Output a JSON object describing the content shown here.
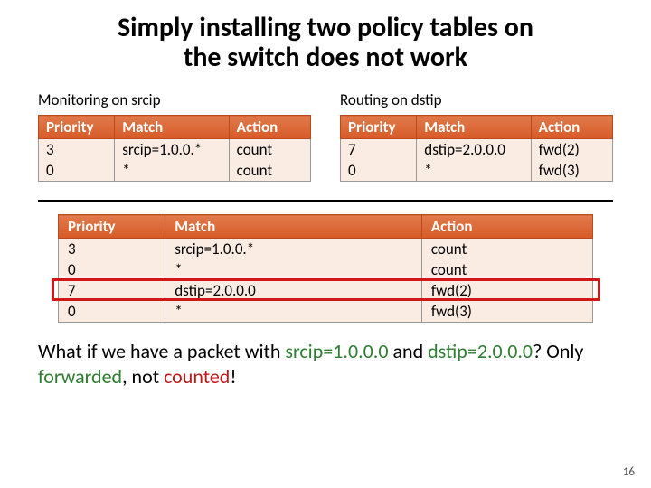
{
  "title_line1": "Simply installing two policy tables on",
  "title_line2": "the switch does not work",
  "left": {
    "label": "Monitoring on srcip",
    "headers": {
      "c1": "Priority",
      "c2": "Match",
      "c3": "Action"
    },
    "rows": [
      {
        "priority": "3",
        "match": "srcip=1.0.0.*",
        "action": "count"
      },
      {
        "priority": "0",
        "match": "*",
        "action": "count"
      }
    ]
  },
  "right": {
    "label": "Routing on dstip",
    "headers": {
      "c1": "Priority",
      "c2": "Match",
      "c3": "Action"
    },
    "rows": [
      {
        "priority": "7",
        "match": "dstip=2.0.0.0",
        "action": "fwd(2)"
      },
      {
        "priority": "0",
        "match": "*",
        "action": "fwd(3)"
      }
    ]
  },
  "combined": {
    "headers": {
      "c1": "Priority",
      "c2": "Match",
      "c3": "Action"
    },
    "rows": [
      {
        "priority": "3",
        "match": "srcip=1.0.0.*",
        "action": "count",
        "hl": false
      },
      {
        "priority": "0",
        "match": "*",
        "action": "count",
        "hl": false
      },
      {
        "priority": "7",
        "match": "dstip=2.0.0.0",
        "action": "fwd(2)",
        "hl": true
      },
      {
        "priority": "0",
        "match": "*",
        "action": "fwd(3)",
        "hl": false
      }
    ]
  },
  "question": {
    "pre": "What if we have a packet with ",
    "ip1": "srcip=1.0.0.0",
    "mid1": " and ",
    "ip2": "dstip=2.0.0.0",
    "mid2": "? Only ",
    "fwd": "forwarded",
    "mid3": ", not ",
    "cnt": "counted",
    "post": "!"
  },
  "page_num": "16"
}
